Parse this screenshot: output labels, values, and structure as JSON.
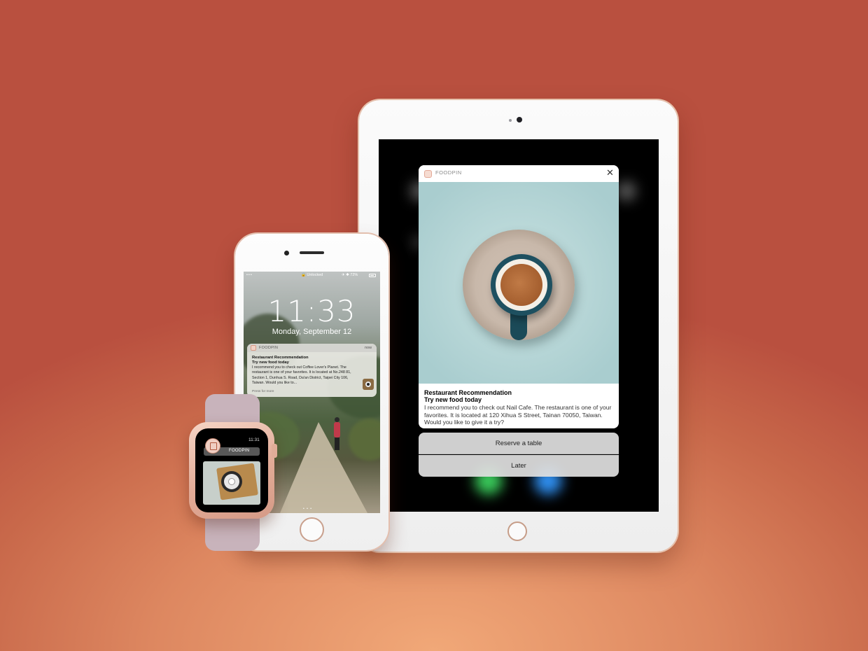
{
  "ipad": {
    "notification": {
      "app_name": "FOODPIN",
      "close_glyph": "✕",
      "title": "Restaurant Recommendation",
      "subtitle": "Try new food today",
      "body": "I recommend you to check out Nail Cafe. The restaurant is one of your favorites. It is located at 120 Xihua S Street, Tainan 70050, Taiwan. Would you like to give it a try?",
      "image_icon": "coffee-cup-image"
    },
    "actions": {
      "reserve_label": "Reserve a table",
      "later_label": "Later"
    }
  },
  "iphone": {
    "status": {
      "signal": "•••",
      "wifi_icon": "wifi-icon",
      "lock_label": "🔒 Unlocked",
      "right_text": "✈ ✱ 72%"
    },
    "lock_screen": {
      "time": "11:33",
      "date": "Monday, September 12"
    },
    "notification": {
      "app_name": "FOODPIN",
      "time": "now",
      "title": "Restaurant Recommendation",
      "subtitle": "Try new food today",
      "body": "I recommend you to check out Coffee Lover's Planet. The restaurant is one of your favorites. It is located at No.248 81, Section 1, Dunhua S. Road, Da'an District, Taipei City 106, Taiwan. Would you like to...",
      "hint": "Press for more"
    },
    "page_dots": "• • •"
  },
  "watch": {
    "time": "11:31",
    "app_name": "FOODPIN"
  },
  "colors": {
    "bg_top": "#b9503f",
    "bg_bottom": "#f1a878",
    "gold_trim": "#e3bfae"
  }
}
